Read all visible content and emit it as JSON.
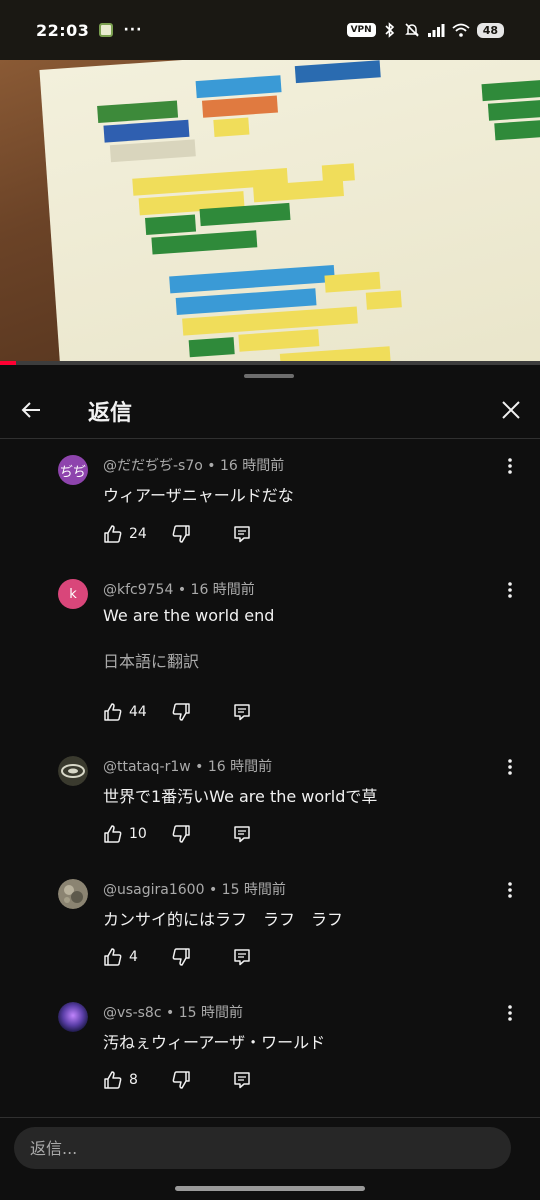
{
  "status_bar": {
    "time": "22:03",
    "dots": "···",
    "vpn": "VPN",
    "battery": "48"
  },
  "video": {
    "progress_fraction": 0.03
  },
  "header": {
    "title": "返信"
  },
  "comments": [
    {
      "handle": "@だだぢぢ-s7o",
      "age": "16 時間前",
      "text": "ウィアーザニャールドだな",
      "likes": "24",
      "avatar_text": "ぢぢ",
      "avatar_color": "#8e44ad"
    },
    {
      "handle": "@kfc9754",
      "age": "16 時間前",
      "text": "We are the world end",
      "translate": "日本語に翻訳",
      "likes": "44",
      "avatar_text": "k",
      "avatar_color": "#d9467a"
    },
    {
      "handle": "@ttataq-r1w",
      "age": "16 時間前",
      "text": "世界で1番汚いWe are the worldで草",
      "likes": "10",
      "avatar_text": "",
      "avatar_color": "#3a3a2e"
    },
    {
      "handle": "@usagira1600",
      "age": "15 時間前",
      "text": "カンサイ的にはラフ　ラフ　ラフ",
      "likes": "4",
      "avatar_text": "",
      "avatar_color": "#8b8472"
    },
    {
      "handle": "@vs-s8c",
      "age": "15 時間前",
      "text": "汚ねぇウィーアーザ・ワールド",
      "likes": "8",
      "avatar_text": "",
      "avatar_color": "#5b3fa8"
    }
  ],
  "reply_input": {
    "placeholder": "返信..."
  }
}
